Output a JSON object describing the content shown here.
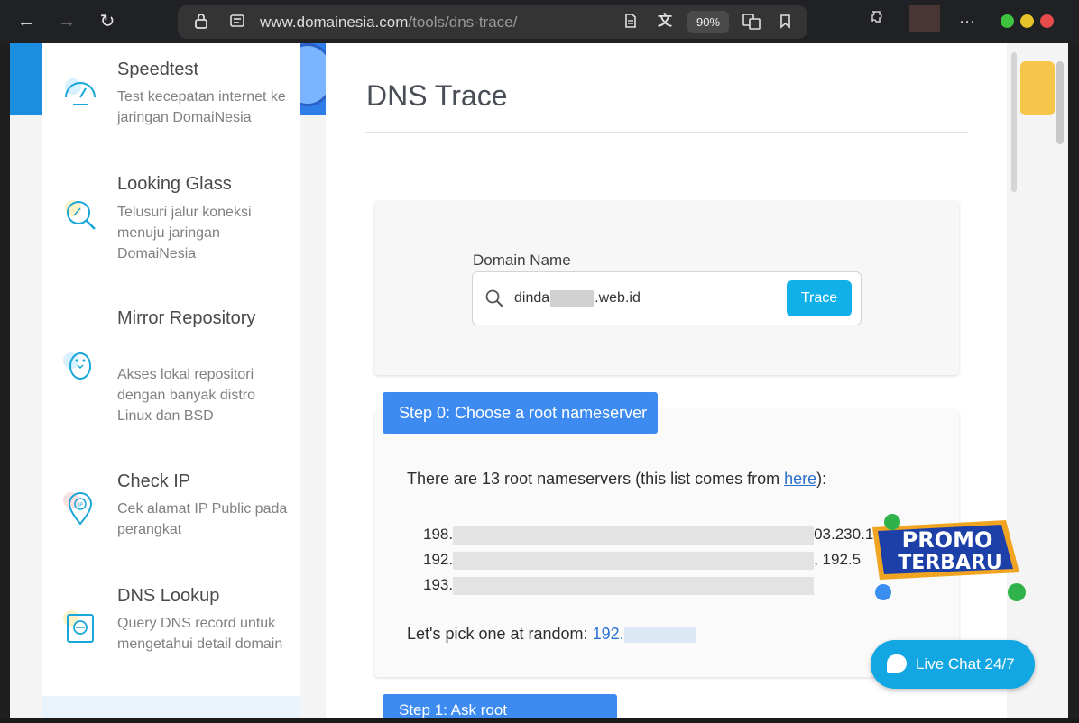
{
  "browser": {
    "url_host": "www.domainesia.com",
    "url_path": "/tools/dns-trace/",
    "zoom": "90%"
  },
  "sidebar": {
    "items": [
      {
        "title": "Speedtest",
        "desc": "Test kecepatan internet ke jaringan DomaiNesia",
        "icon": "speedometer-icon"
      },
      {
        "title": "Looking Glass",
        "desc": "Telusuri jalur koneksi menuju jaringan DomaiNesia",
        "icon": "magnifier-icon"
      },
      {
        "title": "Mirror Repository",
        "desc": "Akses lokal repositori dengan banyak distro Linux dan BSD",
        "icon": "penguin-icon"
      },
      {
        "title": "Check IP",
        "desc": "Cek alamat IP Public pada perangkat",
        "icon": "location-pin-icon"
      },
      {
        "title": "DNS Lookup",
        "desc": "Query DNS record untuk mengetahui detail domain",
        "icon": "dns-search-icon"
      }
    ]
  },
  "main": {
    "title": "DNS Trace",
    "form": {
      "label": "Domain Name",
      "value_prefix": "dinda",
      "value_suffix": ".web.id",
      "button": "Trace"
    },
    "step0": {
      "header": "Step 0: Choose a root nameserver",
      "intro_before": "There are 13 root nameservers (this list comes from ",
      "intro_link": "here",
      "intro_after": "):",
      "ns_lines": [
        "198.",
        "192.",
        "193."
      ],
      "ns_line1_tail": "03.230.10",
      "ns_line2_tail": ", 192.5",
      "pick_label": "Let's pick one at random: ",
      "pick_value": "192."
    },
    "step1": {
      "header": "Step 1: Ask root"
    }
  },
  "widgets": {
    "promo_line1": "PROMO",
    "promo_line2": "TERBARU",
    "livechat": "Live Chat 24/7"
  }
}
